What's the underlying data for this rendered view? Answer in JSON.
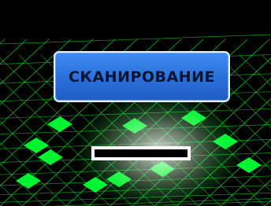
{
  "screen": {
    "title": "СКАНИРОВАНИЕ",
    "progress_fraction": 0.0,
    "colors": {
      "background": "#000000",
      "grid": "#00ff33",
      "highlight": "#ffffff",
      "banner": "#2a6fd8",
      "banner_text": "#0b1430"
    }
  }
}
